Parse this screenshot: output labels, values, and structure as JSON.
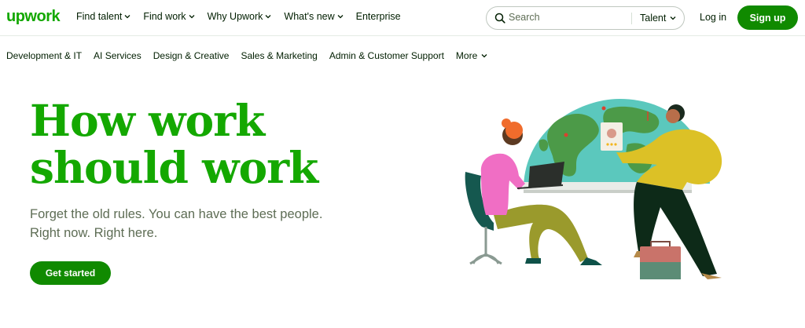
{
  "brand": {
    "logo_text": "upwork",
    "color": "#14a800"
  },
  "topnav": {
    "links": [
      {
        "label": "Find talent",
        "has_dropdown": true
      },
      {
        "label": "Find work",
        "has_dropdown": true
      },
      {
        "label": "Why Upwork",
        "has_dropdown": true
      },
      {
        "label": "What's new",
        "has_dropdown": true
      },
      {
        "label": "Enterprise",
        "has_dropdown": false
      }
    ],
    "search": {
      "placeholder": "Search",
      "filter_label": "Talent"
    },
    "login_label": "Log in",
    "signup_label": "Sign up"
  },
  "categories": {
    "items": [
      "Development & IT",
      "AI Services",
      "Design & Creative",
      "Sales & Marketing",
      "Admin & Customer Support"
    ],
    "more_label": "More"
  },
  "hero": {
    "title_line1": "How work",
    "title_line2": "should work",
    "subtitle_line1": "Forget the old rules. You can have the best people.",
    "subtitle_line2": "Right now. Right here.",
    "cta_label": "Get started"
  },
  "colors": {
    "accent": "#14a800",
    "button": "#108a00",
    "text": "#001e00",
    "muted": "#5e6d55"
  }
}
